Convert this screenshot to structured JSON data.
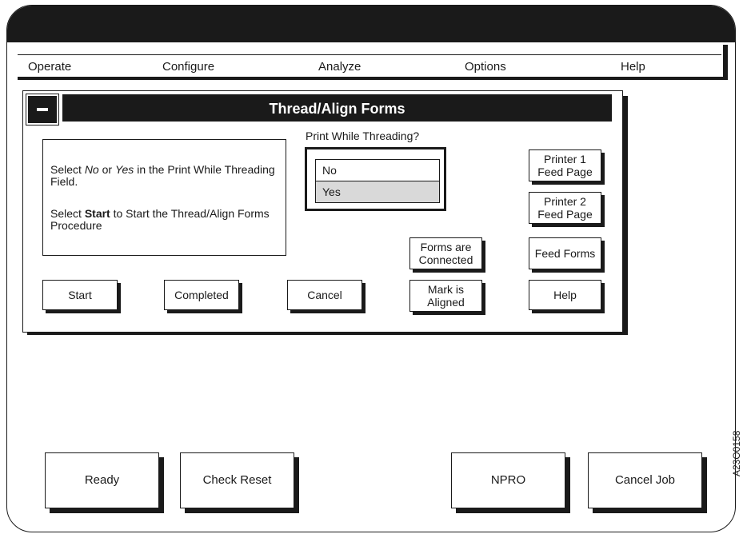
{
  "menu": {
    "items": [
      "Operate",
      "Configure",
      "Analyze",
      "Options",
      "Help"
    ]
  },
  "dialog": {
    "system_menu_symbol": "−",
    "title": "Thread/Align Forms",
    "instructions": {
      "line1_pre": "Select ",
      "line1_no": "No",
      "line1_mid": " or ",
      "line1_yes": "Yes",
      "line1_post": " in the Print While Threading Field.",
      "line2_pre": "Select ",
      "line2_start": "Start",
      "line2_post": " to Start the Thread/Align Forms Procedure"
    },
    "print_while_threading": {
      "label": "Print While Threading?",
      "options": [
        "No",
        "Yes"
      ],
      "selected": "Yes"
    },
    "buttons": {
      "start": "Start",
      "completed": "Completed",
      "cancel": "Cancel",
      "forms_connected": "Forms are\nConnected",
      "mark_aligned": "Mark is\nAligned",
      "printer1_feed": "Printer 1\nFeed Page",
      "printer2_feed": "Printer 2\nFeed Page",
      "feed_forms": "Feed Forms",
      "help": "Help"
    }
  },
  "bottom_buttons": {
    "ready": "Ready",
    "check_reset": "Check Reset",
    "npro": "NPRO",
    "cancel_job": "Cancel Job"
  },
  "figure_id": "A23O0158"
}
